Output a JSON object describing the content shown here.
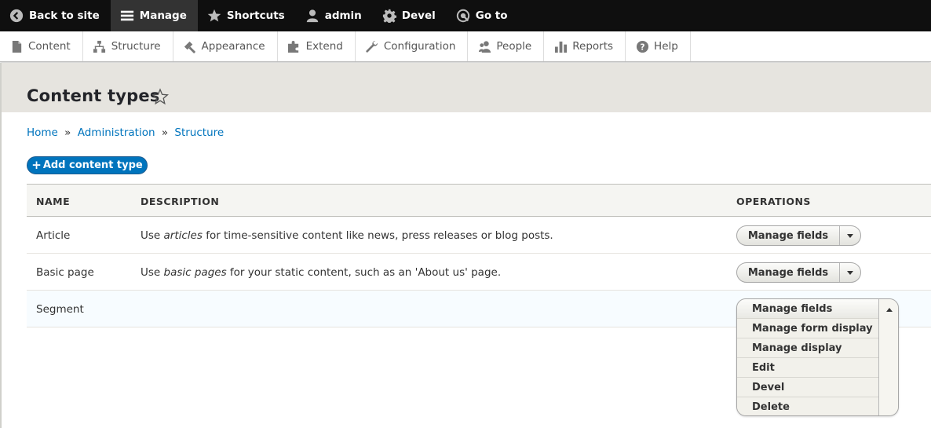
{
  "toolbar": {
    "items": [
      {
        "label": "Back to site",
        "icon": "back-arrow-icon"
      },
      {
        "label": "Manage",
        "icon": "hamburger-menu-icon",
        "active": true
      },
      {
        "label": "Shortcuts",
        "icon": "star-icon"
      },
      {
        "label": "admin",
        "icon": "user-icon"
      },
      {
        "label": "Devel",
        "icon": "gear-icon"
      },
      {
        "label": "Go to",
        "icon": "goto-icon"
      }
    ]
  },
  "tray": {
    "items": [
      {
        "label": "Content",
        "icon": "file-icon"
      },
      {
        "label": "Structure",
        "icon": "sitemap-icon"
      },
      {
        "label": "Appearance",
        "icon": "paintbrush-icon"
      },
      {
        "label": "Extend",
        "icon": "puzzle-icon"
      },
      {
        "label": "Configuration",
        "icon": "wrench-icon"
      },
      {
        "label": "People",
        "icon": "people-icon"
      },
      {
        "label": "Reports",
        "icon": "bar-chart-icon"
      },
      {
        "label": "Help",
        "icon": "help-icon"
      }
    ]
  },
  "page": {
    "title": "Content types"
  },
  "breadcrumb": {
    "items": [
      "Home",
      "Administration",
      "Structure"
    ],
    "separator": "»"
  },
  "actions": {
    "add_plus": "+",
    "add_label": "Add content type"
  },
  "table": {
    "headers": {
      "name": "NAME",
      "description": "DESCRIPTION",
      "operations": "OPERATIONS"
    },
    "rows": [
      {
        "name": "Article",
        "desc_before": "Use ",
        "desc_em": "articles",
        "desc_after": " for time-sensitive content like news, press releases or blog posts.",
        "operation": "Manage fields"
      },
      {
        "name": "Basic page",
        "desc_before": "Use ",
        "desc_em": "basic pages",
        "desc_after": " for your static content, such as an 'About us' page.",
        "operation": "Manage fields"
      },
      {
        "name": "Segment",
        "desc_before": "",
        "desc_em": "",
        "desc_after": "",
        "operation": "Manage fields"
      }
    ]
  },
  "dropdown_open": {
    "options": [
      "Manage fields",
      "Manage form display",
      "Manage display",
      "Edit",
      "Devel",
      "Delete"
    ]
  },
  "colors": {
    "toolbar_bg": "#0f0f0f",
    "link": "#0074bd",
    "button_primary": "#0074bd",
    "header_bg": "#e6e4df"
  }
}
